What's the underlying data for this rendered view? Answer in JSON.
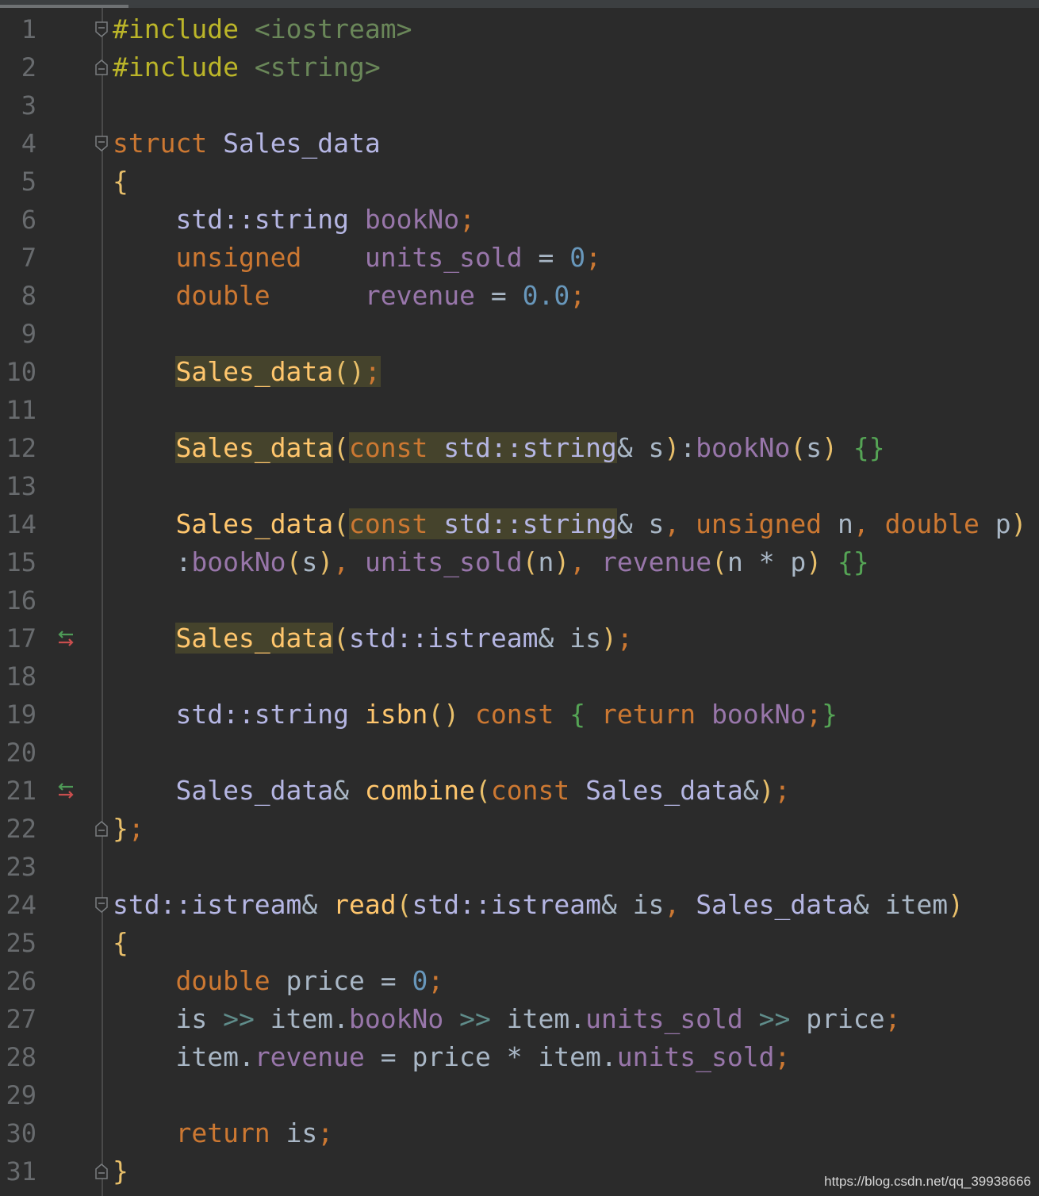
{
  "colors": {
    "background": "#2b2b2b",
    "line_number": "#686b6e",
    "keyword": "#cc7832",
    "preprocessor": "#bbb529",
    "include_path": "#6a8759",
    "class_name": "#b5b6e3",
    "identifier": "#a9b7c6",
    "field": "#9876aa",
    "function": "#ffc66d",
    "number": "#6897bb",
    "brace": "#e8bf6a",
    "operator": "#5f8c8a",
    "inner_brace": "#55a455"
  },
  "gutter_markers": [
    {
      "line": "17",
      "icon": "implementation-arrows-icon"
    },
    {
      "line": "21",
      "icon": "implementation-arrows-icon"
    }
  ],
  "lines": [
    {
      "n": "1",
      "fold": "fold-open",
      "tokens": [
        {
          "t": "#include",
          "c": "#bbb529"
        },
        {
          "t": " ",
          "c": "#a9b7c6"
        },
        {
          "t": "<iostream>",
          "c": "#6a8759"
        }
      ]
    },
    {
      "n": "2",
      "fold": "fold-close",
      "tokens": [
        {
          "t": "#include",
          "c": "#bbb529"
        },
        {
          "t": " ",
          "c": "#a9b7c6"
        },
        {
          "t": "<string>",
          "c": "#6a8759"
        }
      ]
    },
    {
      "n": "3",
      "fold": "",
      "tokens": []
    },
    {
      "n": "4",
      "fold": "fold-open",
      "tokens": [
        {
          "t": "struct",
          "c": "#cc7832"
        },
        {
          "t": " ",
          "c": "#a9b7c6"
        },
        {
          "t": "Sales_data",
          "c": "#b5b6e3"
        }
      ]
    },
    {
      "n": "5",
      "fold": "",
      "tokens": [
        {
          "t": "{",
          "c": "#e8bf6a"
        }
      ]
    },
    {
      "n": "6",
      "fold": "",
      "tokens": [
        {
          "t": "    std::string ",
          "c": "#b5b6e3"
        },
        {
          "t": "bookNo",
          "c": "#9876aa"
        },
        {
          "t": ";",
          "c": "#cc7832"
        }
      ]
    },
    {
      "n": "7",
      "fold": "",
      "tokens": [
        {
          "t": "    unsigned",
          "c": "#cc7832"
        },
        {
          "t": "    ",
          "c": "#a9b7c6"
        },
        {
          "t": "units_sold",
          "c": "#9876aa"
        },
        {
          "t": " = ",
          "c": "#a9b7c6"
        },
        {
          "t": "0",
          "c": "#6897bb"
        },
        {
          "t": ";",
          "c": "#cc7832"
        }
      ]
    },
    {
      "n": "8",
      "fold": "",
      "tokens": [
        {
          "t": "    double",
          "c": "#cc7832"
        },
        {
          "t": "      ",
          "c": "#a9b7c6"
        },
        {
          "t": "revenue",
          "c": "#9876aa"
        },
        {
          "t": " = ",
          "c": "#a9b7c6"
        },
        {
          "t": "0.0",
          "c": "#6897bb"
        },
        {
          "t": ";",
          "c": "#cc7832"
        }
      ]
    },
    {
      "n": "9",
      "fold": "",
      "tokens": []
    },
    {
      "n": "10",
      "fold": "",
      "tokens": [
        {
          "t": "    ",
          "c": "#a9b7c6"
        },
        {
          "t": "Sales_data",
          "c": "#ffc66d",
          "hl": true
        },
        {
          "t": "()",
          "c": "#e8bf6a",
          "hl": true
        },
        {
          "t": ";",
          "c": "#cc7832",
          "hl": true
        }
      ]
    },
    {
      "n": "11",
      "fold": "",
      "tokens": []
    },
    {
      "n": "12",
      "fold": "",
      "tokens": [
        {
          "t": "    ",
          "c": "#a9b7c6"
        },
        {
          "t": "Sales_data",
          "c": "#ffc66d",
          "hl": true
        },
        {
          "t": "(",
          "c": "#e8bf6a"
        },
        {
          "t": "const",
          "c": "#cc7832",
          "hl": true
        },
        {
          "t": " std::string",
          "c": "#b5b6e3",
          "hl": true
        },
        {
          "t": "& s",
          "c": "#a9b7c6"
        },
        {
          "t": ")",
          "c": "#e8bf6a"
        },
        {
          "t": ":",
          "c": "#a9b7c6"
        },
        {
          "t": "bookNo",
          "c": "#9876aa"
        },
        {
          "t": "(",
          "c": "#e8bf6a"
        },
        {
          "t": "s",
          "c": "#a9b7c6"
        },
        {
          "t": ")",
          "c": "#e8bf6a"
        },
        {
          "t": " ",
          "c": "#a9b7c6"
        },
        {
          "t": "{}",
          "c": "#55a455"
        }
      ]
    },
    {
      "n": "13",
      "fold": "",
      "tokens": []
    },
    {
      "n": "14",
      "fold": "",
      "tokens": [
        {
          "t": "    ",
          "c": "#a9b7c6"
        },
        {
          "t": "Sales_data",
          "c": "#ffc66d"
        },
        {
          "t": "(",
          "c": "#e8bf6a"
        },
        {
          "t": "const",
          "c": "#cc7832",
          "hl": true
        },
        {
          "t": " std::string",
          "c": "#b5b6e3",
          "hl": true
        },
        {
          "t": "& s",
          "c": "#a9b7c6"
        },
        {
          "t": ", ",
          "c": "#cc7832"
        },
        {
          "t": "unsigned",
          "c": "#cc7832"
        },
        {
          "t": " n",
          "c": "#a9b7c6"
        },
        {
          "t": ", ",
          "c": "#cc7832"
        },
        {
          "t": "double",
          "c": "#cc7832"
        },
        {
          "t": " p",
          "c": "#a9b7c6"
        },
        {
          "t": ")",
          "c": "#e8bf6a"
        }
      ]
    },
    {
      "n": "15",
      "fold": "",
      "tokens": [
        {
          "t": "    :",
          "c": "#a9b7c6"
        },
        {
          "t": "bookNo",
          "c": "#9876aa"
        },
        {
          "t": "(",
          "c": "#e8bf6a"
        },
        {
          "t": "s",
          "c": "#a9b7c6"
        },
        {
          "t": ")",
          "c": "#e8bf6a"
        },
        {
          "t": ", ",
          "c": "#cc7832"
        },
        {
          "t": "units_sold",
          "c": "#9876aa"
        },
        {
          "t": "(",
          "c": "#e8bf6a"
        },
        {
          "t": "n",
          "c": "#a9b7c6"
        },
        {
          "t": ")",
          "c": "#e8bf6a"
        },
        {
          "t": ", ",
          "c": "#cc7832"
        },
        {
          "t": "revenue",
          "c": "#9876aa"
        },
        {
          "t": "(",
          "c": "#e8bf6a"
        },
        {
          "t": "n * p",
          "c": "#a9b7c6"
        },
        {
          "t": ")",
          "c": "#e8bf6a"
        },
        {
          "t": " ",
          "c": "#a9b7c6"
        },
        {
          "t": "{}",
          "c": "#55a455"
        }
      ]
    },
    {
      "n": "16",
      "fold": "",
      "tokens": []
    },
    {
      "n": "17",
      "fold": "",
      "tokens": [
        {
          "t": "    ",
          "c": "#a9b7c6"
        },
        {
          "t": "Sales_data",
          "c": "#ffc66d",
          "hl": true
        },
        {
          "t": "(",
          "c": "#e8bf6a"
        },
        {
          "t": "std::istream",
          "c": "#b5b6e3"
        },
        {
          "t": "& is",
          "c": "#a9b7c6"
        },
        {
          "t": ")",
          "c": "#e8bf6a"
        },
        {
          "t": ";",
          "c": "#cc7832"
        }
      ]
    },
    {
      "n": "18",
      "fold": "",
      "tokens": []
    },
    {
      "n": "19",
      "fold": "",
      "tokens": [
        {
          "t": "    std::string ",
          "c": "#b5b6e3"
        },
        {
          "t": "isbn",
          "c": "#ffc66d"
        },
        {
          "t": "()",
          "c": "#e8bf6a"
        },
        {
          "t": " ",
          "c": "#a9b7c6"
        },
        {
          "t": "const",
          "c": "#cc7832"
        },
        {
          "t": " ",
          "c": "#a9b7c6"
        },
        {
          "t": "{",
          "c": "#55a455"
        },
        {
          "t": " ",
          "c": "#a9b7c6"
        },
        {
          "t": "return",
          "c": "#cc7832"
        },
        {
          "t": " ",
          "c": "#a9b7c6"
        },
        {
          "t": "bookNo",
          "c": "#9876aa"
        },
        {
          "t": ";",
          "c": "#cc7832"
        },
        {
          "t": "}",
          "c": "#55a455"
        }
      ]
    },
    {
      "n": "20",
      "fold": "",
      "tokens": []
    },
    {
      "n": "21",
      "fold": "",
      "tokens": [
        {
          "t": "    Sales_data",
          "c": "#b5b6e3"
        },
        {
          "t": "& ",
          "c": "#a9b7c6"
        },
        {
          "t": "combine",
          "c": "#ffc66d"
        },
        {
          "t": "(",
          "c": "#e8bf6a"
        },
        {
          "t": "const",
          "c": "#cc7832"
        },
        {
          "t": " Sales_data",
          "c": "#b5b6e3"
        },
        {
          "t": "&",
          "c": "#a9b7c6"
        },
        {
          "t": ")",
          "c": "#e8bf6a"
        },
        {
          "t": ";",
          "c": "#cc7832"
        }
      ]
    },
    {
      "n": "22",
      "fold": "fold-close",
      "tokens": [
        {
          "t": "}",
          "c": "#e8bf6a"
        },
        {
          "t": ";",
          "c": "#cc7832"
        }
      ]
    },
    {
      "n": "23",
      "fold": "",
      "tokens": []
    },
    {
      "n": "24",
      "fold": "fold-open",
      "tokens": [
        {
          "t": "std::istream",
          "c": "#b5b6e3"
        },
        {
          "t": "& ",
          "c": "#a9b7c6"
        },
        {
          "t": "read",
          "c": "#ffc66d"
        },
        {
          "t": "(",
          "c": "#e8bf6a"
        },
        {
          "t": "std::istream",
          "c": "#b5b6e3"
        },
        {
          "t": "& is",
          "c": "#a9b7c6"
        },
        {
          "t": ", ",
          "c": "#cc7832"
        },
        {
          "t": "Sales_data",
          "c": "#b5b6e3"
        },
        {
          "t": "& item",
          "c": "#a9b7c6"
        },
        {
          "t": ")",
          "c": "#e8bf6a"
        }
      ]
    },
    {
      "n": "25",
      "fold": "",
      "tokens": [
        {
          "t": "{",
          "c": "#e8bf6a"
        }
      ]
    },
    {
      "n": "26",
      "fold": "",
      "tokens": [
        {
          "t": "    double",
          "c": "#cc7832"
        },
        {
          "t": " price = ",
          "c": "#a9b7c6"
        },
        {
          "t": "0",
          "c": "#6897bb"
        },
        {
          "t": ";",
          "c": "#cc7832"
        }
      ]
    },
    {
      "n": "27",
      "fold": "",
      "tokens": [
        {
          "t": "    is ",
          "c": "#a9b7c6"
        },
        {
          "t": ">>",
          "c": "#5f8c8a"
        },
        {
          "t": " item.",
          "c": "#a9b7c6"
        },
        {
          "t": "bookNo",
          "c": "#9876aa"
        },
        {
          "t": " ",
          "c": "#a9b7c6"
        },
        {
          "t": ">>",
          "c": "#5f8c8a"
        },
        {
          "t": " item.",
          "c": "#a9b7c6"
        },
        {
          "t": "units_sold",
          "c": "#9876aa"
        },
        {
          "t": " ",
          "c": "#a9b7c6"
        },
        {
          "t": ">>",
          "c": "#5f8c8a"
        },
        {
          "t": " price",
          "c": "#a9b7c6"
        },
        {
          "t": ";",
          "c": "#cc7832"
        }
      ]
    },
    {
      "n": "28",
      "fold": "",
      "tokens": [
        {
          "t": "    item.",
          "c": "#a9b7c6"
        },
        {
          "t": "revenue",
          "c": "#9876aa"
        },
        {
          "t": " = price * item.",
          "c": "#a9b7c6"
        },
        {
          "t": "units_sold",
          "c": "#9876aa"
        },
        {
          "t": ";",
          "c": "#cc7832"
        }
      ]
    },
    {
      "n": "29",
      "fold": "",
      "tokens": []
    },
    {
      "n": "30",
      "fold": "",
      "tokens": [
        {
          "t": "    return",
          "c": "#cc7832"
        },
        {
          "t": " is",
          "c": "#a9b7c6"
        },
        {
          "t": ";",
          "c": "#cc7832"
        }
      ]
    },
    {
      "n": "31",
      "fold": "fold-close",
      "tokens": [
        {
          "t": "}",
          "c": "#e8bf6a"
        }
      ]
    }
  ],
  "watermark": "https://blog.csdn.net/qq_39938666"
}
